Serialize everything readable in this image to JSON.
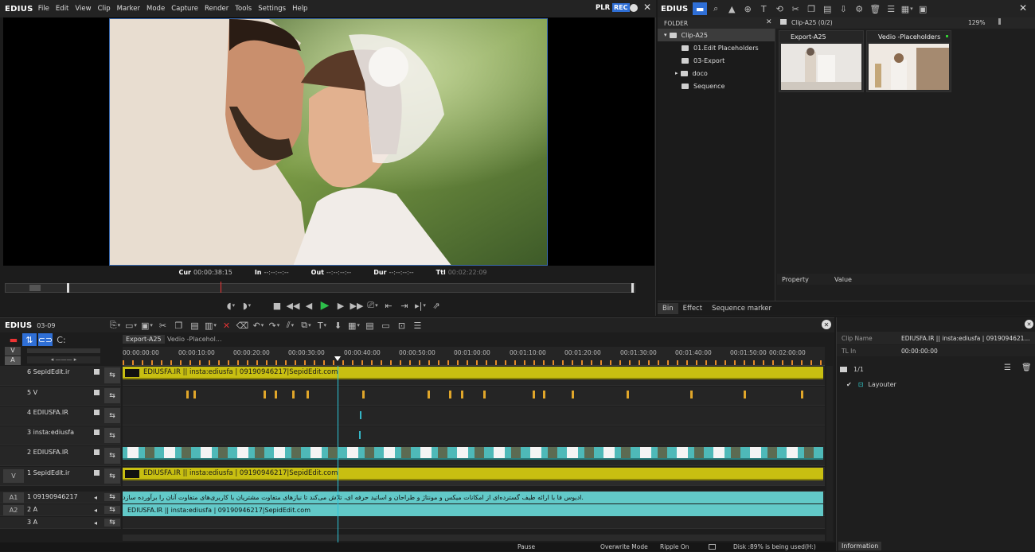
{
  "app": {
    "logo": "EDIUS"
  },
  "menu": [
    "File",
    "Edit",
    "View",
    "Clip",
    "Marker",
    "Mode",
    "Capture",
    "Render",
    "Tools",
    "Settings",
    "Help"
  ],
  "player": {
    "mode_plr": "PLR",
    "mode_rec": "REC",
    "cur_label": "Cur",
    "cur": "00:00:38:15",
    "in_label": "In",
    "in": "--:--:--:--",
    "out_label": "Out",
    "out": "--:--:--:--",
    "dur_label": "Dur",
    "dur": "--:--:--:--",
    "ttl_label": "Ttl",
    "ttl": "00:02:22:09"
  },
  "bin": {
    "logo": "EDIUS",
    "zoom": "129%",
    "folder_header": "FOLDER",
    "path": "Clip-A25 (0/2)",
    "folders": [
      "Clip-A25",
      "01.Edit Placeholders",
      "03-Export",
      "doco",
      "Sequence"
    ],
    "clips": [
      {
        "name": "Export-A25"
      },
      {
        "name": "Vedio -Placeholders"
      }
    ],
    "prop_cols": [
      "Property",
      "Value"
    ],
    "tabs": [
      "Bin",
      "Effect",
      "Sequence marker"
    ]
  },
  "timeline": {
    "logo": "EDIUS",
    "project": "03-09",
    "seq_tabs": [
      "Export-A25",
      "Vedio -Placehol..."
    ],
    "ruler": [
      "00:00:00:00",
      "00:00:10:00",
      "00:00:20:00",
      "00:00:30:00",
      "00:00:40:00",
      "00:00:50:00",
      "00:01:00:00",
      "00:01:10:00",
      "00:01:20:00",
      "00:01:30:00",
      "00:01:40:00",
      "00:01:50:00",
      "00:02:00:00"
    ],
    "tracks": [
      {
        "label": "6 SepidEdit.ir"
      },
      {
        "label": "5 V"
      },
      {
        "label": "4 EDIUSFA.IR"
      },
      {
        "label": "3 insta:ediusfa"
      },
      {
        "label": "2 EDIUSFA.IR"
      },
      {
        "label": "1 SepidEdit.ir",
        "side": "V"
      }
    ],
    "audio_tracks": [
      {
        "side": "A1",
        "label": "1 09190946217"
      },
      {
        "side": "A2",
        "label": "2 A"
      },
      {
        "side": "",
        "label": "3 A"
      }
    ],
    "clip_text": "EDIUSFA.IR || insta:ediusfa |  09190946217|SepidEdit.com",
    "audio_text_1": ".ادیوس فا  با ارائه طیف گسترده‌ای از امکانات میکس و مونتاژ و طراحان و اساتید حرفه ای، تلاش می‌کند تا نیازهای متفاوت مشتریان با کاربری‌های متفاوت آنان را برآورده سازد",
    "audio_text_2": "EDIUSFA.IR || insta:ediusfa |  09190946217|SepidEdit.com",
    "v_label": "V",
    "a_label": "A"
  },
  "info": {
    "clip_name_label": "Clip Name",
    "clip_name": "EDIUSFA.IR || insta:ediusfa |  0919094621...",
    "tl_in_label": "TL In",
    "tl_in": "00:00:00:00",
    "count": "1/1",
    "item": "Layouter",
    "tab": "Information"
  },
  "status": {
    "pause": "Pause",
    "mode": "Overwrite Mode",
    "ripple": "Ripple On",
    "disk": "Disk :89% is being used(H:)"
  },
  "colors": {
    "accent": "#2f6fd6",
    "clip_yellow": "#c8bf11",
    "clip_cyan": "#62c9c8",
    "play_green": "#2dbf4a"
  }
}
